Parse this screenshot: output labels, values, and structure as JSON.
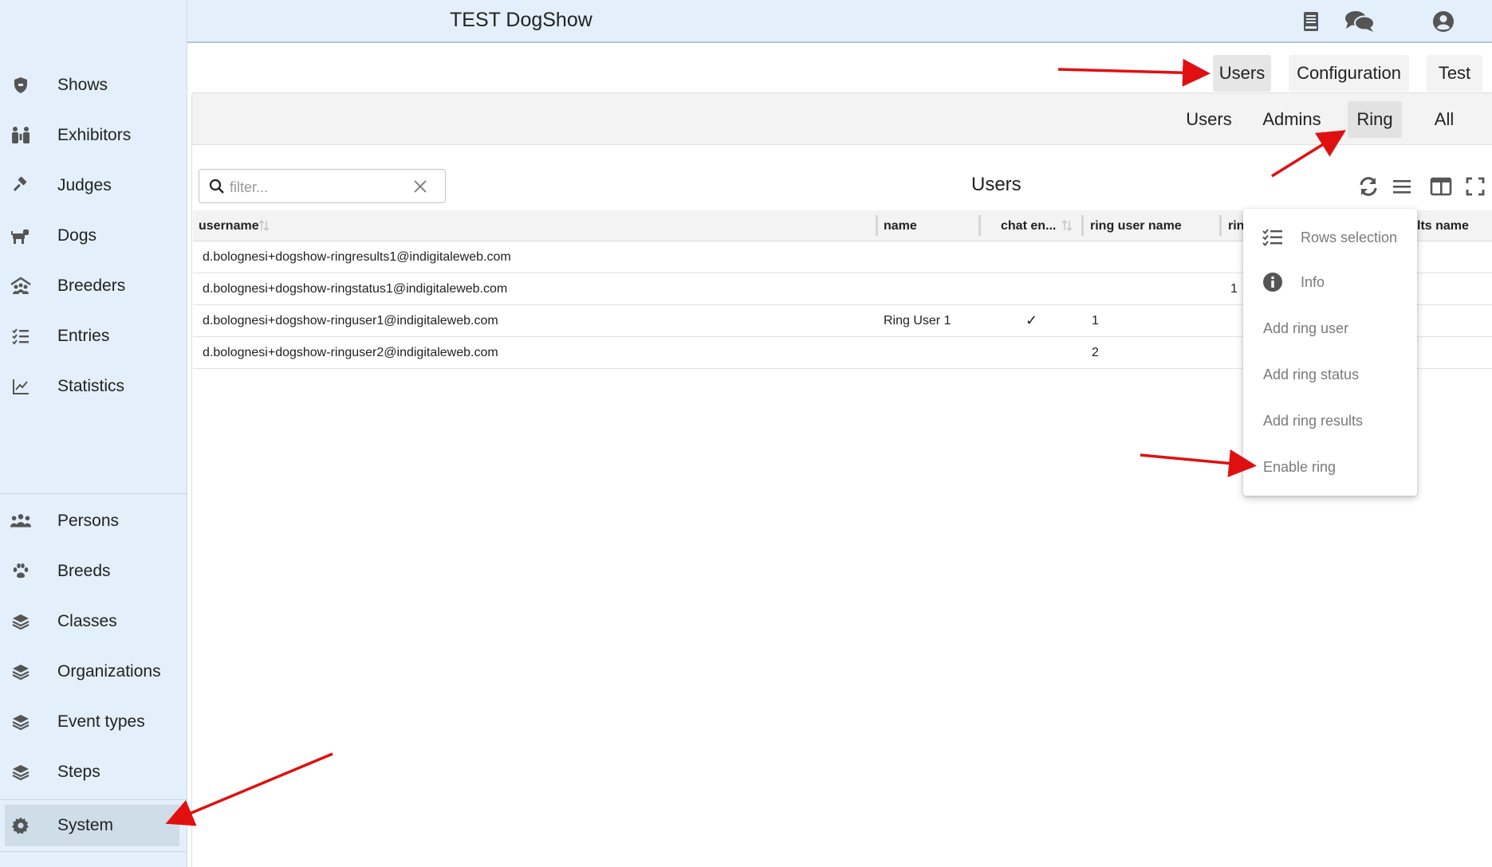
{
  "header": {
    "title": "TEST DogShow",
    "icons": [
      "book-icon",
      "chat-icon",
      "account-icon"
    ]
  },
  "sidebar": {
    "items": [
      {
        "label": "Shows",
        "icon": "shield-icon"
      },
      {
        "label": "Exhibitors",
        "icon": "people-icon"
      },
      {
        "label": "Judges",
        "icon": "gavel-icon"
      },
      {
        "label": "Dogs",
        "icon": "dog-icon"
      },
      {
        "label": "Breeders",
        "icon": "breeders-icon"
      },
      {
        "label": "Entries",
        "icon": "checklist-icon"
      },
      {
        "label": "Statistics",
        "icon": "chart-line-icon"
      }
    ],
    "system_items": [
      {
        "label": "Persons",
        "icon": "group-icon"
      },
      {
        "label": "Breeds",
        "icon": "paw-icon"
      },
      {
        "label": "Classes",
        "icon": "layers-icon"
      },
      {
        "label": "Organizations",
        "icon": "layers-icon"
      },
      {
        "label": "Event types",
        "icon": "layers-icon"
      },
      {
        "label": "Steps",
        "icon": "layers-icon"
      }
    ],
    "active_item": {
      "label": "System",
      "icon": "gear-icon"
    }
  },
  "top_tabs": [
    {
      "label": "Users",
      "selected": true
    },
    {
      "label": "Configuration",
      "selected": false
    },
    {
      "label": "Test",
      "selected": false
    }
  ],
  "sub_tabs": [
    {
      "label": "Users",
      "selected": false
    },
    {
      "label": "Admins",
      "selected": false
    },
    {
      "label": "Ring",
      "selected": true
    },
    {
      "label": "All",
      "selected": false
    }
  ],
  "toolbar": {
    "filter_placeholder": "filter...",
    "filter_value": "",
    "title": "Users",
    "icons": [
      "refresh-icon",
      "menu-icon",
      "columns-icon",
      "fullscreen-icon"
    ]
  },
  "table": {
    "columns": [
      "username",
      "name",
      "chat en...",
      "ring user name",
      "rin",
      "lts name"
    ],
    "rows": [
      {
        "username": "d.bolognesi+dogshow-ringresults1@indigitaleweb.com",
        "name": "",
        "chat": false,
        "ring_user_name": "",
        "rin": ""
      },
      {
        "username": "d.bolognesi+dogshow-ringstatus1@indigitaleweb.com",
        "name": "",
        "chat": false,
        "ring_user_name": "",
        "rin": "1"
      },
      {
        "username": "d.bolognesi+dogshow-ringuser1@indigitaleweb.com",
        "name": "Ring User 1",
        "chat": true,
        "ring_user_name": "1",
        "rin": ""
      },
      {
        "username": "d.bolognesi+dogshow-ringuser2@indigitaleweb.com",
        "name": "",
        "chat": false,
        "ring_user_name": "2",
        "rin": ""
      }
    ],
    "check_mark": "✓"
  },
  "menu": {
    "items": [
      {
        "label": "Rows selection",
        "icon": "checklist-icon"
      },
      {
        "label": "Info",
        "icon": "info-icon"
      },
      {
        "label": "Add ring user",
        "icon": ""
      },
      {
        "label": "Add ring status",
        "icon": ""
      },
      {
        "label": "Add ring results",
        "icon": ""
      },
      {
        "label": "Enable ring",
        "icon": ""
      }
    ]
  },
  "colors": {
    "sidebar_bg": "#e3f0fb",
    "header_bg": "#e3f0fb",
    "active_item_bg": "#cfdde8",
    "annotation_arrow": "#e01010",
    "icon_gray": "#555555"
  }
}
